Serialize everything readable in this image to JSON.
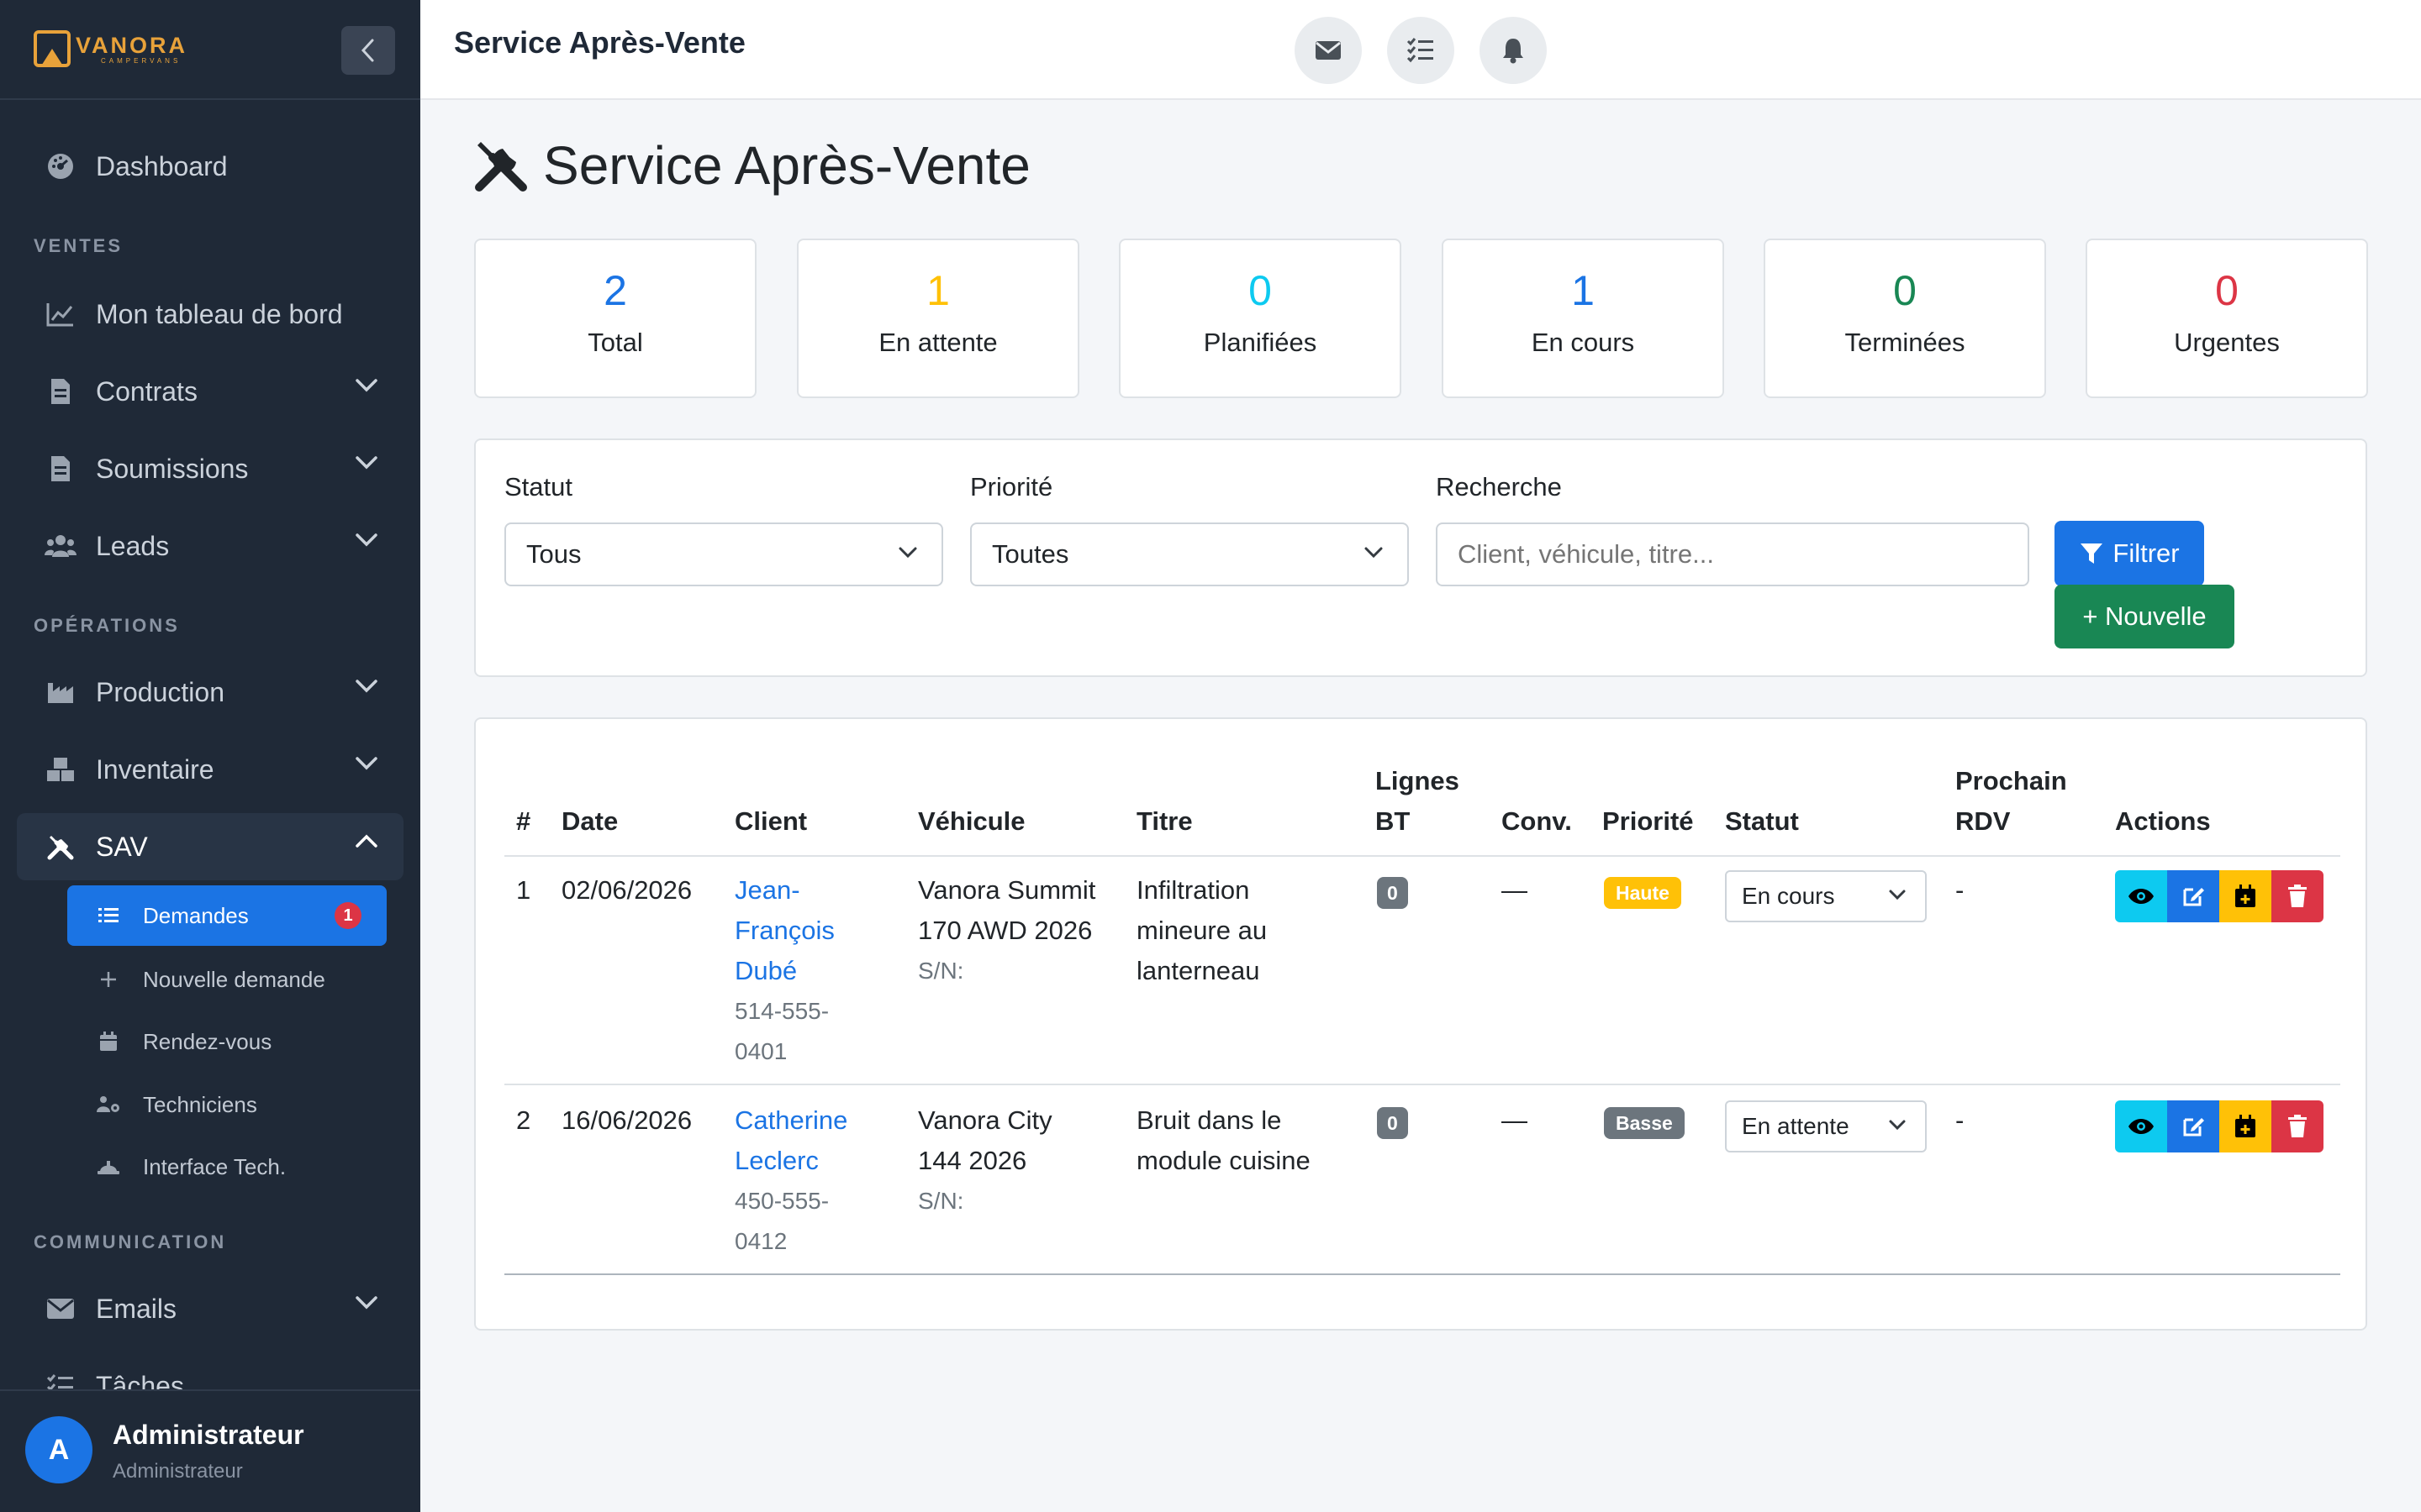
{
  "brand": {
    "name": "VANORA",
    "sub": "CAMPERVANS"
  },
  "sidebar": {
    "dashboard": "Dashboard",
    "sections": {
      "ventes": "VENTES",
      "operations": "OPÉRATIONS",
      "communication": "COMMUNICATION"
    },
    "items": {
      "tableau": "Mon tableau de bord",
      "contrats": "Contrats",
      "soumissions": "Soumissions",
      "leads": "Leads",
      "production": "Production",
      "inventaire": "Inventaire",
      "sav": "SAV",
      "emails": "Emails",
      "taches": "Tâches"
    },
    "sav_sub": {
      "demandes": "Demandes",
      "demandes_badge": "1",
      "nouvelle": "Nouvelle demande",
      "rdv": "Rendez-vous",
      "techniciens": "Techniciens",
      "interface": "Interface Tech."
    },
    "user": {
      "initial": "A",
      "name": "Administrateur",
      "role": "Administrateur"
    }
  },
  "topbar": {
    "title": "Service Après-Vente"
  },
  "page": {
    "title": "Service Après-Vente"
  },
  "stats": [
    {
      "value": "2",
      "label": "Total",
      "color": "#1b74e4"
    },
    {
      "value": "1",
      "label": "En attente",
      "color": "#ffc107"
    },
    {
      "value": "0",
      "label": "Planifiées",
      "color": "#0dcaf0"
    },
    {
      "value": "1",
      "label": "En cours",
      "color": "#1b74e4"
    },
    {
      "value": "0",
      "label": "Terminées",
      "color": "#198754"
    },
    {
      "value": "0",
      "label": "Urgentes",
      "color": "#dc3545"
    }
  ],
  "filters": {
    "statut_label": "Statut",
    "statut_value": "Tous",
    "priorite_label": "Priorité",
    "priorite_value": "Toutes",
    "recherche_label": "Recherche",
    "recherche_placeholder": "Client, véhicule, titre...",
    "filter_button": "Filtrer",
    "new_button": "+ Nouvelle"
  },
  "table": {
    "headers": {
      "num": "#",
      "date": "Date",
      "client": "Client",
      "vehicule": "Véhicule",
      "titre": "Titre",
      "lignes_1": "Lignes",
      "lignes_2": "BT",
      "conv": "Conv.",
      "priorite": "Priorité",
      "statut": "Statut",
      "rdv_1": "Prochain",
      "rdv_2": "RDV",
      "actions": "Actions"
    },
    "rows": [
      {
        "num": "1",
        "date": "02/06/2026",
        "client_1": "Jean-",
        "client_2": "François",
        "client_3": "Dubé",
        "phone_1": "514-555-",
        "phone_2": "0401",
        "vehicule_1": "Vanora Summit",
        "vehicule_2": "170 AWD 2026",
        "sn": "S/N:",
        "titre_1": "Infiltration",
        "titre_2": "mineure au",
        "titre_3": "lanterneau",
        "lignes": "0",
        "conv": "—",
        "priorite": "Haute",
        "statut": "En cours",
        "rdv": "-"
      },
      {
        "num": "2",
        "date": "16/06/2026",
        "client_1": "Catherine",
        "client_2": "Leclerc",
        "phone_1": "450-555-",
        "phone_2": "0412",
        "vehicule_1": "Vanora City",
        "vehicule_2": "144 2026",
        "sn": "S/N:",
        "titre_1": "Bruit dans le",
        "titre_2": "module cuisine",
        "lignes": "0",
        "conv": "—",
        "priorite": "Basse",
        "statut": "En attente",
        "rdv": "-"
      }
    ]
  },
  "colors": {
    "primary": "#1b74e4",
    "success": "#198754",
    "warning": "#ffc107",
    "info": "#0dcaf0",
    "danger": "#dc3545",
    "sidebar": "#1f2937"
  }
}
